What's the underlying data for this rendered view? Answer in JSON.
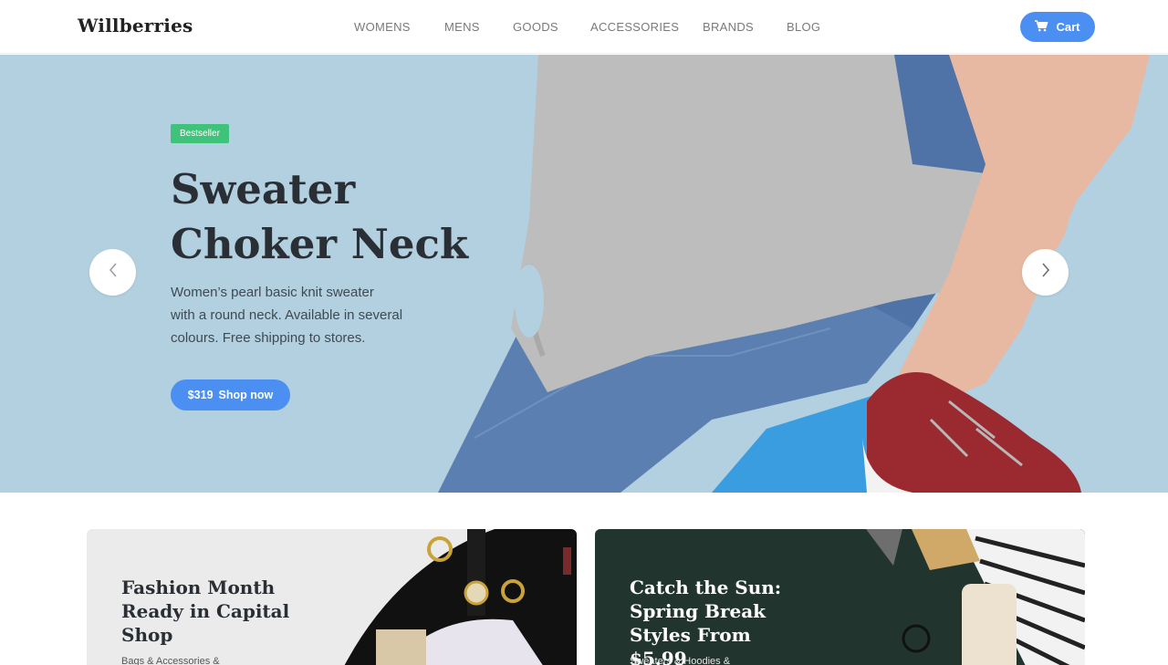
{
  "header": {
    "logo": "Willberries",
    "nav": [
      {
        "label": "WOMENS"
      },
      {
        "label": "MENS"
      },
      {
        "label": "GOODS"
      },
      {
        "label": "ACCESSORIES"
      },
      {
        "label": "BRANDS"
      },
      {
        "label": "BLOG"
      }
    ],
    "cart_label": "Cart",
    "cart_icon": "cart-icon"
  },
  "hero": {
    "badge": "Bestseller",
    "title_line1": "Sweater",
    "title_line2": "Choker Neck",
    "desc_line1": "Women’s pearl basic knit sweater",
    "desc_line2": "with a round neck. Available in several",
    "desc_line3": "colours. Free shipping to stores.",
    "price": "$319",
    "shop_label": "Shop now",
    "prev_icon": "chevron-left-icon",
    "next_icon": "chevron-right-icon"
  },
  "promos": [
    {
      "title_line1": "Fashion Month",
      "title_line2": "Ready in Capital",
      "title_line3": "Shop",
      "subtitle": "Bags & Accessories &"
    },
    {
      "title_line1": "Catch the Sun:",
      "title_line2": "Spring Break",
      "title_line3": "Styles From $5.99",
      "subtitle": "Sweaters & Hoodies &"
    }
  ],
  "colors": {
    "accent": "#4a8ff1",
    "badge": "#3fc27a",
    "hero_bg": "#b2d0df",
    "card_dark": "#21352e"
  }
}
